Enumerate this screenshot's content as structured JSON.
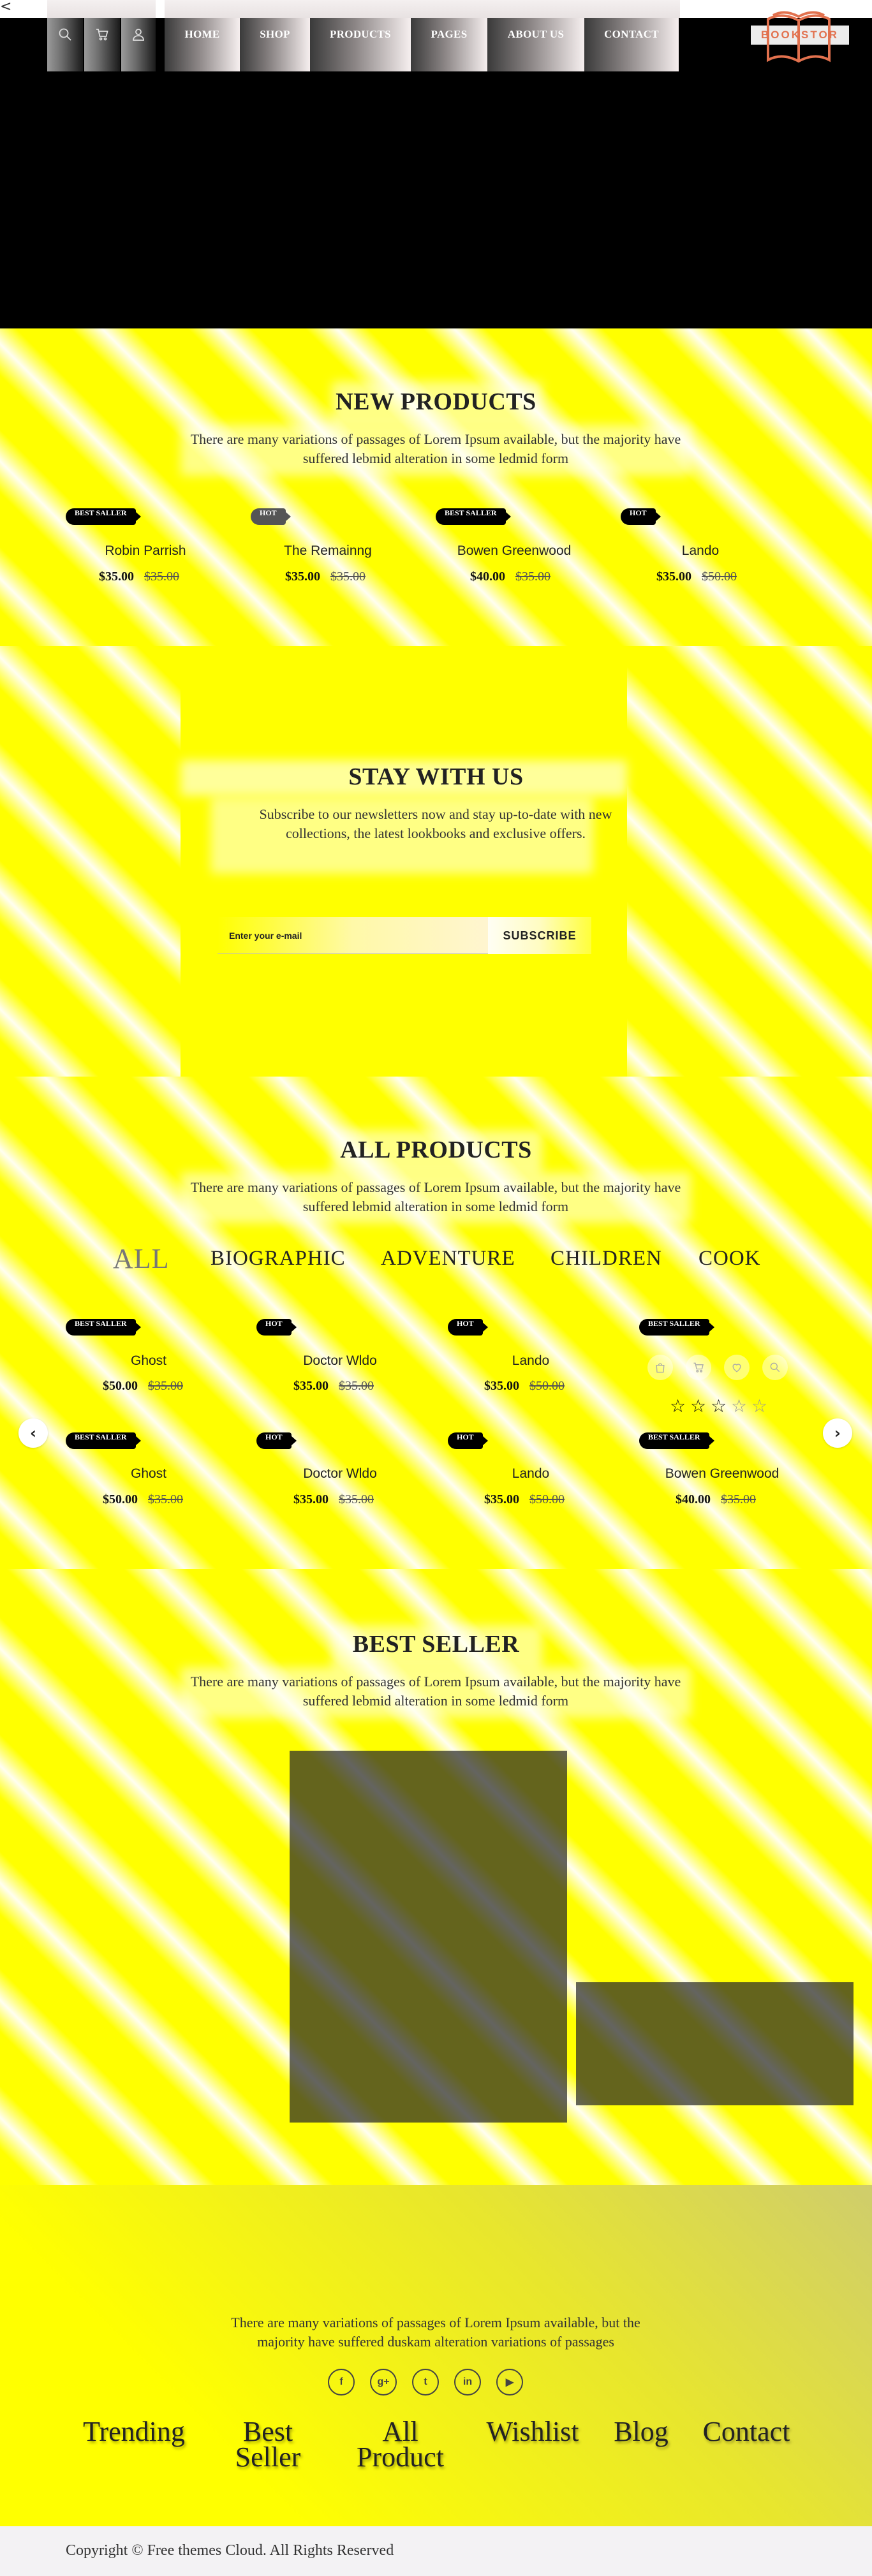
{
  "header": {
    "nav": [
      "HOME",
      "SHOP",
      "PRODUCTS",
      "PAGES",
      "ABOUT US",
      "CONTACT"
    ],
    "icons": [
      "search-icon",
      "cart-icon",
      "user-icon"
    ],
    "logo_text": "BOOKSTOR",
    "back_glyph": "<"
  },
  "new_products": {
    "title_a": "NEW",
    "title_b": "PRODUCTS",
    "subtitle": "There are many variations of passages of Lorem Ipsum available, but the majority have suffered lebmid alteration in some ledmid form",
    "items": [
      {
        "badge": "BEST SALLER",
        "name": "Robin Parrish",
        "price": "$35.00",
        "old_price": "$35.00"
      },
      {
        "badge": "HOT",
        "name": "The Remainng",
        "price": "$35.00",
        "old_price": "$35.00"
      },
      {
        "badge": "BEST SALLER",
        "name": "Bowen Greenwood",
        "price": "$40.00",
        "old_price": "$35.00"
      },
      {
        "badge": "HOT",
        "name": "Lando",
        "price": "$35.00",
        "old_price": "$50.00"
      }
    ]
  },
  "newsletter": {
    "title": "STAY WITH US",
    "text": "Subscribe to our newsletters now and stay up-to-date with new collections, the latest lookbooks and exclusive offers.",
    "placeholder": "Enter your e-mail",
    "button": "SUBSCRIBE"
  },
  "all_products": {
    "title_a": "ALL",
    "title_b": "PRODUCTS",
    "subtitle": "There are many variations of passages of Lorem Ipsum available, but the majority have suffered lebmid alteration in some ledmid form",
    "tabs": [
      "ALL",
      "BIOGRAPHIC",
      "ADVENTURE",
      "CHILDREN",
      "COOK"
    ],
    "row1": [
      {
        "badge": "BEST SALLER",
        "name": "Ghost",
        "price": "$50.00",
        "old_price": "$35.00"
      },
      {
        "badge": "HOT",
        "name": "Doctor Wldo",
        "price": "$35.00",
        "old_price": "$35.00"
      },
      {
        "badge": "HOT",
        "name": "Lando",
        "price": "$35.00",
        "old_price": "$50.00"
      },
      {
        "badge": "BEST SALLER",
        "rating": 3,
        "rating_max": 5
      }
    ],
    "row2": [
      {
        "badge": "BEST SALLER",
        "name": "Ghost",
        "price": "$50.00",
        "old_price": "$35.00"
      },
      {
        "badge": "HOT",
        "name": "Doctor Wldo",
        "price": "$35.00",
        "old_price": "$35.00"
      },
      {
        "badge": "HOT",
        "name": "Lando",
        "price": "$35.00",
        "old_price": "$50.00"
      },
      {
        "badge": "BEST SALLER",
        "name": "Bowen Greenwood",
        "price": "$40.00",
        "old_price": "$35.00"
      }
    ],
    "prev_glyph": "‹",
    "next_glyph": "›"
  },
  "best_seller": {
    "title": "BEST SELLER",
    "subtitle": "There are many variations of passages of Lorem Ipsum available, but the majority have suffered lebmid alteration in some ledmid form"
  },
  "footer": {
    "text": "There are many variations of passages of Lorem Ipsum available, but the majority have suffered duskam alteration variations of passages",
    "social": [
      "facebook-icon",
      "google-plus-icon",
      "tumblr-icon",
      "linkedin-icon",
      "youtube-icon"
    ],
    "links": [
      "Trending",
      "Best Seller",
      "All Product",
      "Wishlist",
      "Blog",
      "Contact"
    ],
    "copyright": "Copyright © Free themes Cloud. All Rights Reserved"
  },
  "colors": {
    "accent_yellow": "#ffff00",
    "logo_orange": "#e2714e",
    "badge_black": "#000000"
  }
}
